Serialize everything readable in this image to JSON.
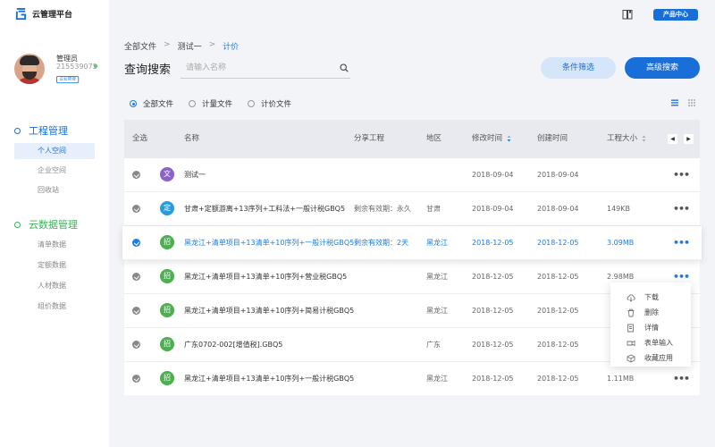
{
  "app": {
    "title": "云管理平台"
  },
  "user": {
    "name": "管理员",
    "id": "215539075",
    "badge": "企业管理"
  },
  "sidebar": {
    "groups": [
      {
        "title": "工程管理",
        "items": [
          {
            "label": "个人空间",
            "active": true
          },
          {
            "label": "企业空间"
          },
          {
            "label": "回收站"
          }
        ]
      },
      {
        "title": "云数据管理",
        "items": [
          {
            "label": "清单数据"
          },
          {
            "label": "定额数据"
          },
          {
            "label": "人材数据"
          },
          {
            "label": "组价数据"
          }
        ]
      }
    ]
  },
  "topbar": {
    "product_center": "产品中心",
    "book_icon": "book-icon"
  },
  "breadcrumb": {
    "root": "全部文件",
    "mid": "测试一",
    "current": "计价",
    "sep": ">"
  },
  "search": {
    "title": "查询搜索",
    "placeholder": "请输入名称"
  },
  "buttons": {
    "filter": "条件筛选",
    "advanced": "高级搜索"
  },
  "filters": {
    "options": [
      "全部文件",
      "计量文件",
      "计价文件"
    ],
    "selected": "全部文件"
  },
  "table": {
    "headers": {
      "select_all": "全选",
      "name": "名称",
      "share": "分享工程",
      "region": "地区",
      "modified": "修改时间",
      "created": "创建时间",
      "size": "工程大小"
    },
    "pager": {
      "prev": "◀",
      "next": "▶"
    },
    "rows": [
      {
        "badge": "文",
        "badge_color": "#8a62c9",
        "name": "测试一",
        "share": "",
        "region": "",
        "modified": "2018-09-04",
        "created": "2018-09-04",
        "size": "",
        "more": "•••"
      },
      {
        "badge": "定",
        "badge_color": "#2a9cdc",
        "name": "甘肃+定额游离+13序列+工料法+一般计税GBQ5",
        "share": "剩余有效期：永久",
        "region": "甘肃",
        "modified": "2018-09-04",
        "created": "2018-09-04",
        "size": "149KB",
        "more": "•••"
      },
      {
        "badge": "招",
        "badge_color": "#4caf50",
        "name": "黑龙江+清单项目+13清单+10序列+一般计税GBQ5",
        "share": "剩余有效期：2天",
        "region": "黑龙江",
        "modified": "2018-12-05",
        "created": "2018-12-05",
        "size": "3.09MB",
        "more": "•••"
      },
      {
        "badge": "招",
        "badge_color": "#4caf50",
        "name": "黑龙江+清单项目+13清单+10序列+营业税GBQ5",
        "share": "",
        "region": "黑龙江",
        "modified": "2018-12-05",
        "created": "2018-12-05",
        "size": "2.98MB",
        "more": "•••"
      },
      {
        "badge": "招",
        "badge_color": "#4caf50",
        "name": "黑龙江+清单项目+13清单+10序列+简易计税GBQ5",
        "share": "",
        "region": "黑龙江",
        "modified": "2018-12-05",
        "created": "2018-12-05",
        "size": "",
        "more": ""
      },
      {
        "badge": "招",
        "badge_color": "#4caf50",
        "name": "广东0702-002[增值税].GBQ5",
        "share": "",
        "region": "广东",
        "modified": "2018-12-05",
        "created": "2018-12-05",
        "size": "",
        "more": ""
      },
      {
        "badge": "招",
        "badge_color": "#4caf50",
        "name": "黑龙江+清单项目+13清单+10序列+一般计税GBQ5",
        "share": "",
        "region": "黑龙江",
        "modified": "2018-12-05",
        "created": "2018-12-05",
        "size": "1.11MB",
        "more": "•••"
      }
    ]
  },
  "menu": {
    "items": [
      "下载",
      "删除",
      "详情",
      "表单输入",
      "收藏应用"
    ]
  },
  "colors": {
    "primary": "#1a6ed8",
    "accent": "#1a7ee8",
    "green": "#3caf5a"
  }
}
